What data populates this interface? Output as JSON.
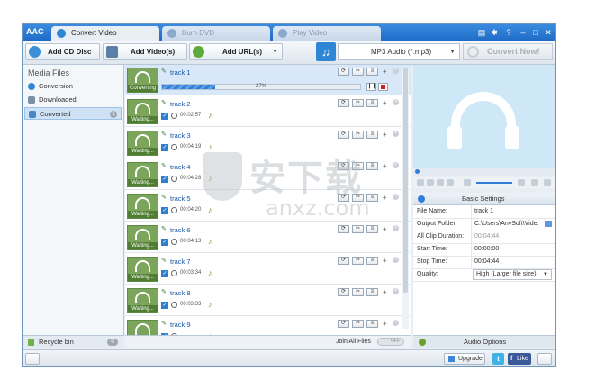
{
  "app": {
    "logo": "AAC"
  },
  "tabs": [
    {
      "label": "Convert Video",
      "active": true
    },
    {
      "label": "Burn DVD",
      "active": false
    },
    {
      "label": "Play Video",
      "active": false
    }
  ],
  "window_controls": {
    "settings": "▤",
    "gear": "✱",
    "help": "?",
    "minimize": "–",
    "maximize": "□",
    "close": "✕"
  },
  "toolbar": {
    "add_cd": "Add CD Disc",
    "add_video": "Add Video(s)",
    "add_url": "Add URL(s)",
    "format": "MP3 Audio (*.mp3)",
    "convert": "Convert Now!"
  },
  "sidebar": {
    "header": "Media Files",
    "items": [
      {
        "label": "Conversion",
        "count": ""
      },
      {
        "label": "Downloaded",
        "count": ""
      },
      {
        "label": "Converted",
        "count": "1"
      }
    ],
    "recycle": {
      "label": "Recycle bin",
      "count": "0"
    }
  },
  "tracks": [
    {
      "name": "track 1",
      "status": "Converting",
      "duration": "",
      "progress_label": "27%",
      "progress": 0.27
    },
    {
      "name": "track 2",
      "status": "Waiting...",
      "duration": "00:02:57"
    },
    {
      "name": "track 3",
      "status": "Waiting...",
      "duration": "00:04:19"
    },
    {
      "name": "track 4",
      "status": "Waiting...",
      "duration": "00:04:28"
    },
    {
      "name": "track 5",
      "status": "Waiting...",
      "duration": "00:04:20"
    },
    {
      "name": "track 6",
      "status": "Waiting...",
      "duration": "00:04:13"
    },
    {
      "name": "track 7",
      "status": "Waiting...",
      "duration": "00:03:34"
    },
    {
      "name": "track 8",
      "status": "Waiting...",
      "duration": "00:03:33"
    },
    {
      "name": "track 9",
      "status": "Waiting...",
      "duration": ""
    }
  ],
  "join": {
    "label": "Join All Files",
    "toggle": "OFF"
  },
  "settings": {
    "header": "Basic Settings",
    "rows": [
      {
        "key": "File Name:",
        "value": "track 1"
      },
      {
        "key": "Output Folder:",
        "value": "C:\\Users\\AnvSoft\\Vide..."
      },
      {
        "key": "All Clip Duration:",
        "value": "00:04:44"
      },
      {
        "key": "Start Time:",
        "value": "00:00:00"
      },
      {
        "key": "Stop Time:",
        "value": "00:04:44"
      },
      {
        "key": "Quality:",
        "value": "High (Larger file size)"
      }
    ]
  },
  "audio_options": "Audio Options",
  "statusbar": {
    "upgrade": "Upgrade",
    "twitter": "t",
    "facebook": "f",
    "like": "Like"
  },
  "watermark": {
    "cn": "安下载",
    "en": "anxz.com"
  },
  "colors": {
    "accent": "#2d86d6",
    "thumb_green": "#7aa55a",
    "titlebar": "#1f6cc7"
  }
}
